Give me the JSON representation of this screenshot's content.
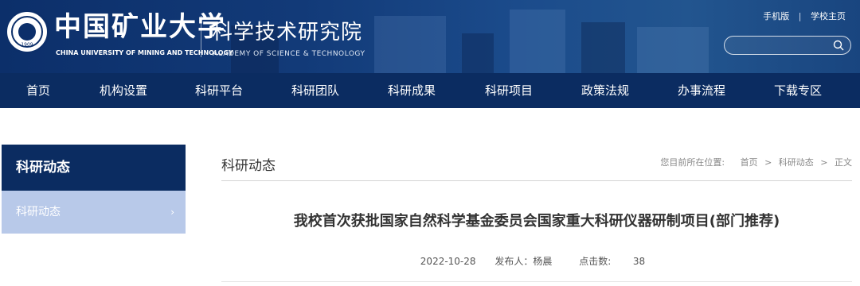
{
  "header": {
    "university_cn": "中国矿业大学",
    "university_en": "CHINA UNIVERSITY OF MINING AND TECHNOLOGY",
    "institute_cn": "科学技术研究院",
    "institute_en": "ACADEMY OF SCIENCE & TECHNOLOGY",
    "emblem_year": "1909",
    "top_links": [
      "手机版",
      "学校主页"
    ],
    "search_placeholder": "",
    "search_icon": "search-icon"
  },
  "nav": {
    "items": [
      "首页",
      "机构设置",
      "科研平台",
      "科研团队",
      "科研成果",
      "科研项目",
      "政策法规",
      "办事流程",
      "下载专区"
    ]
  },
  "sidebar": {
    "title": "科研动态",
    "items": [
      {
        "label": "科研动态",
        "icon": "chevron-right-icon"
      }
    ]
  },
  "main": {
    "section_title": "科研动态",
    "breadcrumb": {
      "label": "您目前所在位置:",
      "items": [
        "首页",
        "科研动态",
        "正文"
      ]
    },
    "article": {
      "title": "我校首次获批国家自然科学基金委员会国家重大科研仪器研制项目(部门推荐)",
      "date": "2022-10-28",
      "publisher": "发布人：杨晨",
      "clicks_label": "点击数:",
      "clicks": "38"
    }
  },
  "colors": {
    "nav_bg": "#0b2c61",
    "header_bg": "#123a78",
    "sidebar_active_bg": "#b8c9e9"
  }
}
